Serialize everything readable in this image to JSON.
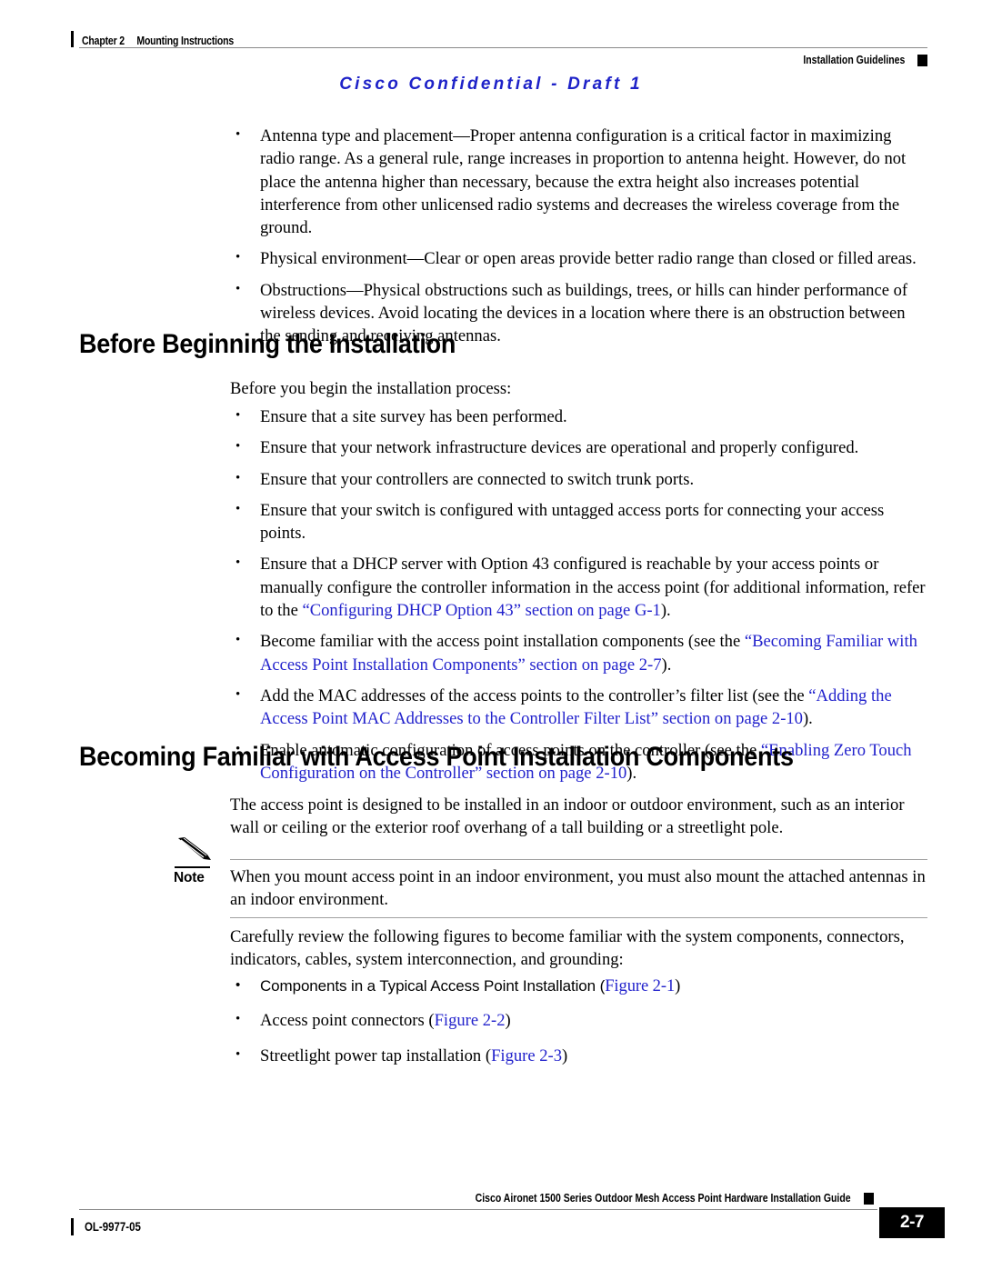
{
  "header": {
    "chapter_number": "Chapter 2",
    "chapter_title": "Mounting Instructions",
    "section_right": "Installation Guidelines",
    "confidential_banner": "Cisco Confidential - Draft 1",
    "confidential_color": "#1e22c8"
  },
  "intro_bullets": [
    "Antenna type and placement—Proper antenna configuration is a critical factor in maximizing radio range. As a general rule, range increases in proportion to antenna height. However, do not place the antenna higher than necessary, because the extra height also increases potential interference from other unlicensed radio systems and decreases the wireless coverage from the ground.",
    "Physical environment—Clear or open areas provide better radio range than closed or filled areas.",
    "Obstructions—Physical obstructions such as buildings, trees, or hills can hinder performance of wireless devices. Avoid locating the devices in a location where there is an obstruction between the sending and receiving antennas."
  ],
  "section1": {
    "heading": "Before Beginning the Installation",
    "lead_in": "Before you begin the installation process:",
    "bullets": [
      {
        "pre": "Ensure that a site survey has been performed.",
        "link": "",
        "post": ""
      },
      {
        "pre": "Ensure that your network infrastructure devices are operational and properly configured.",
        "link": "",
        "post": ""
      },
      {
        "pre": "Ensure that your controllers are connected to switch trunk ports.",
        "link": "",
        "post": ""
      },
      {
        "pre": "Ensure that your switch is configured with untagged access ports for connecting your access points.",
        "link": "",
        "post": ""
      },
      {
        "pre": "Ensure that a DHCP server with Option 43 configured is reachable by your access points or manually configure the controller information in the access point (for additional information, refer to the ",
        "link": "“Configuring DHCP Option 43” section on page G-1",
        "post": ")."
      },
      {
        "pre": "Become familiar with the access point installation components (see the ",
        "link": "“Becoming Familiar with Access Point Installation Components” section on page 2-7",
        "post": ")."
      },
      {
        "pre": "Add the MAC addresses of the access points to the controller’s filter list (see the ",
        "link": "“Adding the Access Point MAC Addresses to the Controller Filter List” section on page 2-10",
        "post": ")."
      },
      {
        "pre": "Enable automatic configuration of access points on the controller (see the ",
        "link": "“Enabling Zero Touch Configuration on the Controller” section on page 2-10",
        "post": ")."
      }
    ]
  },
  "section2": {
    "heading": "Becoming Familiar with Access Point Installation Components",
    "paragraph": "The access point is designed to be installed in an indoor or outdoor environment, such as an interior wall or ceiling or the exterior roof overhang of a tall building or a streetlight pole.",
    "note": {
      "label": "Note",
      "icon": "pencil-icon",
      "text": "When you mount access point in an indoor environment, you must also mount the attached antennas in an indoor environment."
    },
    "closing_paragraph": "Carefully review the following figures to become familiar with the system components, connectors, indicators, cables, system interconnection, and grounding:",
    "figure_bullets": [
      {
        "pre": "Components in a Typical Access Point Installation (",
        "link": "Figure 2-1",
        "post": ")"
      },
      {
        "pre": "Access point connectors (",
        "link": "Figure 2-2",
        "post": ")"
      },
      {
        "pre": "Streetlight power tap installation (",
        "link": "Figure 2-3",
        "post": ")"
      }
    ]
  },
  "footer": {
    "guide_title": "Cisco Aironet 1500 Series Outdoor Mesh Access Point Hardware Installation Guide",
    "doc_id": "OL-9977-05",
    "page_number": "2-7"
  }
}
